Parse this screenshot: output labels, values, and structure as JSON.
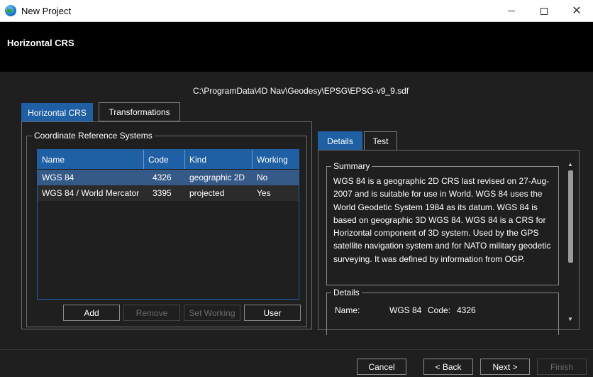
{
  "window": {
    "title": "New Project"
  },
  "header": {
    "title": "Horizontal CRS"
  },
  "file_path": "C:\\ProgramData\\4D Nav\\Geodesy\\EPSG\\EPSG-v9_9.sdf",
  "tabs": {
    "horizontal_crs": "Horizontal CRS",
    "transformations": "Transformations"
  },
  "crs_group": {
    "label": "Coordinate Reference Systems",
    "columns": [
      "Name",
      "Code",
      "Kind",
      "Working"
    ],
    "rows": [
      [
        "WGS 84",
        "4326",
        "geographic 2D",
        "No"
      ],
      [
        "WGS 84 / World Mercator",
        "3395",
        "projected",
        "Yes"
      ]
    ],
    "selected_row": 0
  },
  "buttons": {
    "add": "Add",
    "remove": "Remove",
    "set_working": "Set Working",
    "user": "User"
  },
  "right_tabs": {
    "details": "Details",
    "test": "Test"
  },
  "summary": {
    "label": "Summary",
    "text": "WGS 84 is a geographic 2D CRS last revised on 27-Aug-2007 and is suitable for use in World. WGS 84 uses the World Geodetic System 1984 as its datum. WGS 84 is based on geographic 3D WGS 84. WGS 84 is a CRS for Horizontal component of 3D system. Used by the GPS satellite navigation system and for NATO military geodetic surveying. It was defined by information from OGP."
  },
  "details": {
    "label": "Details",
    "name_label": "Name:",
    "name_value": "WGS 84",
    "code_label": "Code:",
    "code_value": "4326"
  },
  "footer": {
    "cancel": "Cancel",
    "back": "< Back",
    "next": "Next >",
    "finish": "Finish"
  }
}
